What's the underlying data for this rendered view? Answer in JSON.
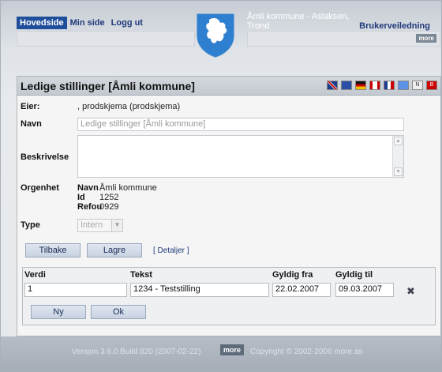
{
  "nav": {
    "items": [
      "Hovedside",
      "Min side",
      "Logg ut"
    ],
    "active_index": 0,
    "help_label": "Brukerveiledning",
    "more_label": "more"
  },
  "tenant": "Åmli kommune - Aslaksen, Trond",
  "panel": {
    "title": "Ledige stillinger [Åmli kommune]",
    "flags": [
      "uk-flag-icon",
      "eu-flag-icon",
      "de-flag-icon",
      "ca-flag-icon",
      "fr-flag-icon",
      "un-flag-icon",
      "nn-flag-icon",
      "nb-flag-icon"
    ],
    "fields": {
      "eier_label": "Eier:",
      "eier_value": ", prodskjema (prodskjema)",
      "navn_label": "Navn",
      "navn_value": "Ledige stillinger [Åmli kommune]",
      "beskrivelse_label": "Beskrivelse",
      "beskrivelse_value": "",
      "orgenhet_label": "Orgenhet",
      "org_navn_label": "Navn",
      "org_navn_value": "Åmli kommune",
      "org_id_label": "Id",
      "org_id_value": "1252",
      "org_refou_label": "Refou",
      "org_refou_value": "0929",
      "type_label": "Type",
      "type_value": "Intern"
    },
    "buttons": {
      "back": "Tilbake",
      "save": "Lagre",
      "details": "[ Detaljer ]"
    }
  },
  "grid": {
    "headers": [
      "Verdi",
      "Tekst",
      "Gyldig fra",
      "Gyldig til"
    ],
    "row": [
      "1",
      "1234 - Teststilling",
      "22.02.2007",
      "09.03.2007"
    ],
    "new_button": "Ny",
    "ok_button": "Ok"
  },
  "footer": {
    "version": "Versjon 3.6.0 Build 820 (2007-02-22)",
    "more_label": "more",
    "copyright": "Copyright © 2002-2006 more as"
  }
}
